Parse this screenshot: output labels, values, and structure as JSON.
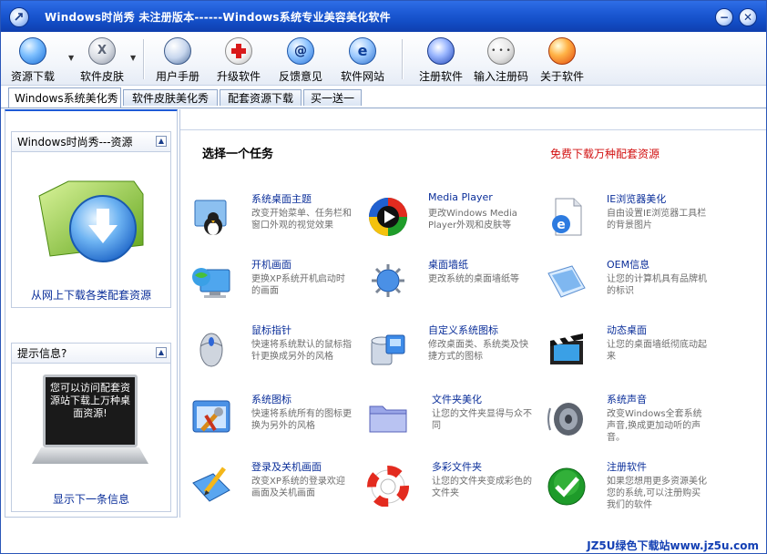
{
  "window": {
    "title": "Windows时尚秀   未注册版本------Windows系统专业美容美化软件"
  },
  "toolbar": {
    "items": [
      {
        "label": "资源下载",
        "icon": "globe-download-icon"
      },
      {
        "label": "软件皮肤",
        "icon": "skin-x-icon"
      },
      {
        "label": "用户手册",
        "icon": "manual-icon"
      },
      {
        "label": "升级软件",
        "icon": "upgrade-cross-icon"
      },
      {
        "label": "反馈意见",
        "icon": "at-sign-icon"
      },
      {
        "label": "软件网站",
        "icon": "ie-icon"
      },
      {
        "label": "注册软件",
        "icon": "register-swirl-icon"
      },
      {
        "label": "输入注册码",
        "icon": "keypad-icon"
      },
      {
        "label": "关于软件",
        "icon": "about-orb-icon"
      }
    ]
  },
  "tabs": [
    {
      "label": "Windows系统美化秀",
      "active": true
    },
    {
      "label": "软件皮肤美化秀",
      "active": false
    },
    {
      "label": "配套资源下载",
      "active": false
    },
    {
      "label": "买一送一",
      "active": false
    }
  ],
  "sidebar": {
    "resource_panel": {
      "title": "Windows时尚秀---资源",
      "link": "从网上下载各类配套资源"
    },
    "tips_panel": {
      "title": "提示信息?",
      "screen_text": "您可以访问配套资源站下载上万种桌面资源!",
      "link": "显示下一条信息"
    }
  },
  "main": {
    "heading": "选择一个任务",
    "promo": "免费下载万种配套资源",
    "tasks": [
      {
        "name": "系统桌面主题",
        "desc": "改变开始菜单、任务栏和窗口外观的视觉效果",
        "icon": "desktop-theme-icon"
      },
      {
        "name": "Media Player",
        "desc": "更改Windows Media Player外观和皮肤等",
        "icon": "media-player-icon"
      },
      {
        "name": "IE浏览器美化",
        "desc": "自由设置IE浏览器工具栏的背景图片",
        "icon": "ie-page-icon"
      },
      {
        "name": "开机画面",
        "desc": "更换XP系统开机启动时的画面",
        "icon": "boot-screen-icon"
      },
      {
        "name": "桌面墙纸",
        "desc": "更改系统的桌面墙纸等",
        "icon": "wallpaper-icon"
      },
      {
        "name": "OEM信息",
        "desc": "让您的计算机具有品牌机的标识",
        "icon": "oem-info-icon"
      },
      {
        "name": "鼠标指针",
        "desc": "快速将系统默认的鼠标指针更换成另外的风格",
        "icon": "mouse-icon"
      },
      {
        "name": "自定义系统图标",
        "desc": "修改桌面类、系统类及快捷方式的图标",
        "icon": "system-icons-icon"
      },
      {
        "name": "动态桌面",
        "desc": "让您的桌面墙纸彻底动起来",
        "icon": "film-clapper-icon"
      },
      {
        "name": "系统图标",
        "desc": "快速将系统所有的图标更换为另外的风格",
        "icon": "tools-icon"
      },
      {
        "name": "文件夹美化",
        "desc": "让您的文件夹显得与众不同",
        "icon": "folder-icon"
      },
      {
        "name": "系统声音",
        "desc": "改变Windows全套系统声音,换成更加动听的声音。",
        "icon": "speaker-icon"
      },
      {
        "name": "登录及关机画面",
        "desc": "改变XP系统的登录欢迎画面及关机画面",
        "icon": "login-pen-icon"
      },
      {
        "name": "多彩文件夹",
        "desc": "让您的文件夹变成彩色的文件夹",
        "icon": "lifebuoy-icon"
      },
      {
        "name": "注册软件",
        "desc": "如果您想用更多资源美化您的系统,可以注册购买我们的软件",
        "icon": "green-check-icon"
      }
    ]
  },
  "footer": {
    "brand": "JZ5U绿色下载站www.jz5u.com"
  }
}
